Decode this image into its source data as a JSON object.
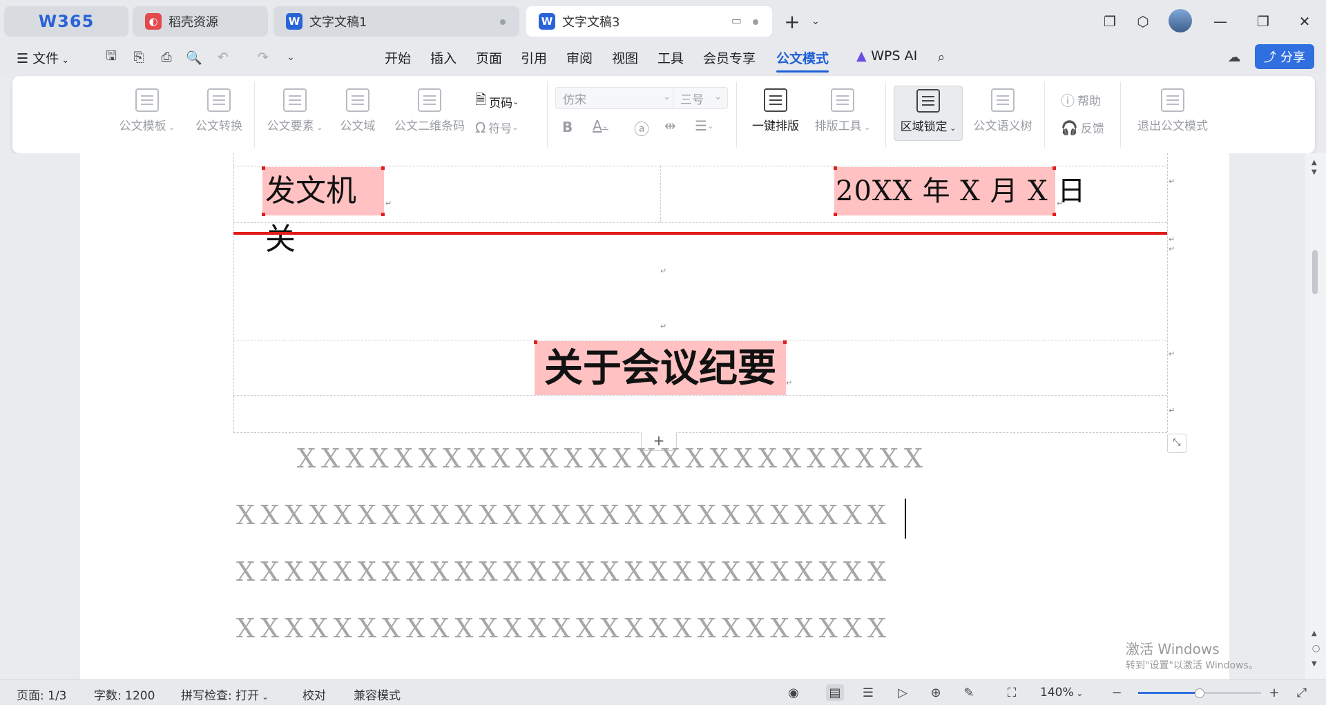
{
  "tabs": [
    {
      "label": "W365",
      "type": "home"
    },
    {
      "label": "稻壳资源",
      "type": "docer"
    },
    {
      "label": "文字文稿1",
      "type": "doc"
    },
    {
      "label": "文字文稿3",
      "type": "doc",
      "active": true
    }
  ],
  "menu": {
    "file_label": "文件",
    "items": [
      "开始",
      "插入",
      "页面",
      "引用",
      "审阅",
      "视图",
      "工具",
      "会员专享",
      "公文模式"
    ],
    "active_item": "公文模式",
    "wps_ai_label": "WPS AI",
    "share_label": "分享"
  },
  "ribbon": {
    "template_label": "公文模板",
    "convert_label": "公文转换",
    "elements_label": "公文要素",
    "field_label": "公文域",
    "qrcode_label": "公文二维条码",
    "pagenum_label": "页码",
    "symbol_label": "符号",
    "font_value": "仿宋",
    "size_value": "三号",
    "one_click_label": "一键排版",
    "layout_tools_label": "排版工具",
    "region_lock_label": "区域锁定",
    "semantic_tree_label": "公文语义树",
    "help_label": "帮助",
    "feedback_label": "反馈",
    "exit_label": "退出公文模式"
  },
  "document": {
    "issuer": "发文机关",
    "date": "20XX 年 X 月 X 日",
    "title": "关于会议纪要",
    "body_lines": [
      "XXXXXXXXXXXXXXXXXXXXXXXXXX",
      "XXXXXXXXXXXXXXXXXXXXXXXXXXX",
      "XXXXXXXXXXXXXXXXXXXXXXXXXXX",
      "XXXXXXXXXXXXXXXXXXXXXXXXXXX"
    ],
    "add_row_symbol": "+"
  },
  "watermark": {
    "line1": "激活 Windows",
    "line2": "转到\"设置\"以激活 Windows。"
  },
  "status": {
    "page": "页面: 1/3",
    "word_count": "字数: 1200",
    "spell_check": "拼写检查: 打开",
    "proof": "校对",
    "compat": "兼容模式",
    "zoom": "140%"
  },
  "colors": {
    "accent": "#1f5fd6",
    "highlight": "#ffc1c1",
    "red_line": "#e21b1b"
  }
}
